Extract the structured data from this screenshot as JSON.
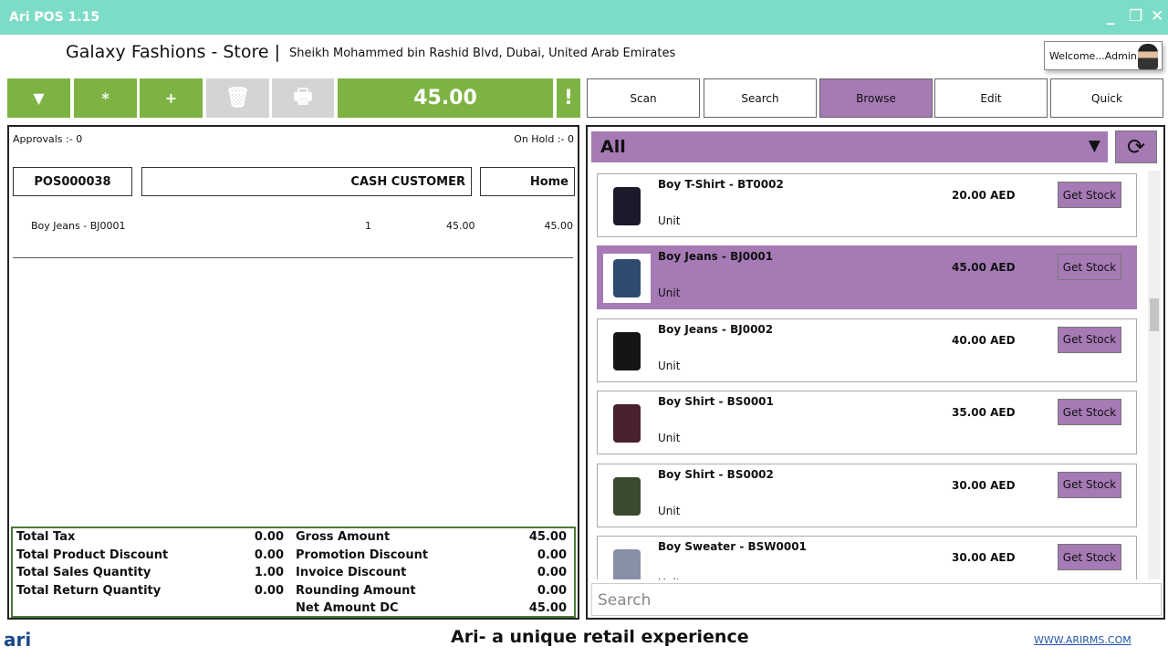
{
  "app": {
    "title": "Ari POS 1.15"
  },
  "header": {
    "store": "Galaxy Fashions - Store |",
    "address": "Sheikh Mohammed bin Rashid Blvd, Dubai, United Arab Emirates",
    "welcome": "Welcome...Admin"
  },
  "toolbar": {
    "star": "*",
    "plus": "+",
    "total": "45.00",
    "alert": "!"
  },
  "nav": [
    "Scan",
    "Search",
    "Browse",
    "Edit",
    "Quick"
  ],
  "order": {
    "approvals": "Approvals :- 0",
    "on_hold": "On Hold :- 0",
    "number": "POS000038",
    "customer": "CASH CUSTOMER",
    "location": "Home",
    "lines": [
      {
        "name": "Boy Jeans - BJ0001",
        "qty": "1",
        "price": "45.00",
        "amount": "45.00"
      }
    ]
  },
  "totals": [
    {
      "l": "Total Tax",
      "lv": "0.00",
      "r": "Gross Amount",
      "rv": "45.00"
    },
    {
      "l": "Total Product Discount",
      "lv": "0.00",
      "r": "Promotion Discount",
      "rv": "0.00"
    },
    {
      "l": "Total Sales Quantity",
      "lv": "1.00",
      "r": "Invoice Discount",
      "rv": "0.00"
    },
    {
      "l": "Total Return Quantity",
      "lv": "0.00",
      "r": "Rounding Amount",
      "rv": "0.00"
    },
    {
      "l": "",
      "lv": "",
      "r": "Net Amount DC",
      "rv": "45.00"
    }
  ],
  "browse": {
    "category": "All",
    "search_placeholder": "Search",
    "get_stock": "Get Stock",
    "products": [
      {
        "name": "Boy  T-Shirt - BT0002",
        "unit": "Unit",
        "price": "20.00  AED",
        "color": "#1a1a2a"
      },
      {
        "name": "Boy Jeans - BJ0001",
        "unit": "Unit",
        "price": "45.00  AED",
        "color": "#2f4a6e"
      },
      {
        "name": "Boy Jeans - BJ0002",
        "unit": "Unit",
        "price": "40.00  AED",
        "color": "#151515"
      },
      {
        "name": "Boy Shirt - BS0001",
        "unit": "Unit",
        "price": "35.00  AED",
        "color": "#4a2030"
      },
      {
        "name": "Boy Shirt - BS0002",
        "unit": "Unit",
        "price": "30.00  AED",
        "color": "#3a4a30"
      },
      {
        "name": "Boy Sweater - BSW0001",
        "unit": "Unit",
        "price": "30.00  AED",
        "color": "#8890a8"
      }
    ]
  },
  "footer": {
    "tagline": "Ari- a unique retail experience",
    "url": "WWW.ARIRMS.COM",
    "logo": "ari"
  },
  "colors": {
    "teal": "#7ddcc8",
    "green": "#7cb342",
    "purple": "#a57ab5"
  }
}
